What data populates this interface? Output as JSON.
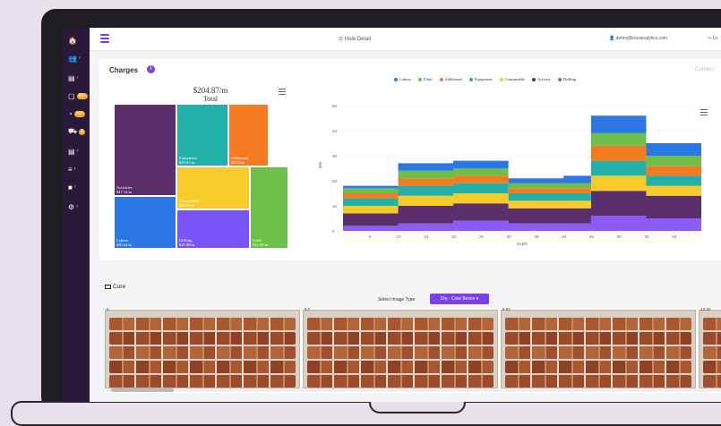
{
  "topbar": {
    "title": "⊙ Hole Detail",
    "user_email": "👤 demo@kruxanalytics.com",
    "logout": "↪ Lo"
  },
  "sidebar": {
    "badges": [
      "99+",
      "99+",
      "9"
    ]
  },
  "charges": {
    "title": "Charges",
    "info": "i",
    "currency_label": "Currenc",
    "treemap": {
      "total_value": "$204.87/m",
      "total_label": "Total",
      "cells": [
        {
          "label": "Activities\n$47.12/m",
          "color": "#5b2f6b"
        },
        {
          "label": "Equipment\n$29.81/m",
          "color": "#22b0a8"
        },
        {
          "label": "Additional\n$20.8/m",
          "color": "#f47b20"
        },
        {
          "label": "Consumable\n$25.88/m",
          "color": "#f7cc2a"
        },
        {
          "label": "Labour\n$39.44/m",
          "color": "#2b78e4"
        },
        {
          "label": "Drilling\n$29.89/m",
          "color": "#7a55f5"
        },
        {
          "label": "Fluid\n$12.56/m",
          "color": "#6cc04a"
        }
      ]
    }
  },
  "chart_data": {
    "type": "area",
    "xlabel": "Depth",
    "ylabel": "$/m",
    "x": [
      0,
      5,
      10,
      15,
      20,
      25,
      30,
      35,
      40,
      45,
      50,
      55,
      60,
      65
    ],
    "x_ticks": [
      "5",
      "10",
      "15",
      "20",
      "25",
      "30",
      "35",
      "40",
      "45",
      "50",
      "55",
      "60"
    ],
    "y_ticks": [
      "0",
      "10",
      "20",
      "30",
      "40",
      "50"
    ],
    "ylim": [
      0,
      50
    ],
    "stacked": true,
    "series": [
      {
        "name": "Drilling",
        "color": "#8b5cf6",
        "values": [
          2,
          2,
          3,
          3,
          4,
          4,
          3,
          3,
          3,
          6,
          6,
          5,
          5,
          5
        ]
      },
      {
        "name": "Activity",
        "color": "#5b2f6b",
        "values": [
          5,
          5,
          7,
          7,
          7,
          7,
          6,
          6,
          6,
          10,
          10,
          9,
          9,
          9
        ]
      },
      {
        "name": "Consumable",
        "color": "#f7cc2a",
        "values": [
          3,
          3,
          4,
          4,
          4,
          4,
          3,
          3,
          3,
          6,
          6,
          4,
          4,
          4
        ]
      },
      {
        "name": "Equipment",
        "color": "#22b0a8",
        "values": [
          3,
          3,
          4,
          4,
          4,
          4,
          3,
          3,
          3,
          6,
          6,
          4,
          4,
          4
        ]
      },
      {
        "name": "Additional",
        "color": "#f47b20",
        "values": [
          2,
          2,
          3,
          3,
          3,
          3,
          2,
          2,
          2,
          6,
          6,
          4,
          4,
          4
        ]
      },
      {
        "name": "Fluid",
        "color": "#6cc04a",
        "values": [
          2,
          2,
          3,
          3,
          3,
          3,
          2,
          2,
          2,
          5,
          5,
          4,
          4,
          4
        ]
      },
      {
        "name": "Labour",
        "color": "#2b78e4",
        "values": [
          1,
          1,
          3,
          3,
          3,
          3,
          2,
          2,
          3,
          7,
          7,
          5,
          5,
          5
        ]
      }
    ],
    "legend": [
      "Labour",
      "Fluid",
      "Additional",
      "Equipment",
      "Consumable",
      "Activity",
      "Drilling"
    ]
  },
  "core": {
    "title": "Core",
    "select_label": "Select Image Type",
    "select_value": "Dry - Core Boxes ▾",
    "boxes": [
      {
        "label": "0"
      },
      {
        "label": "5.7"
      },
      {
        "label": "8.92"
      },
      {
        "label": "13.32"
      }
    ]
  }
}
